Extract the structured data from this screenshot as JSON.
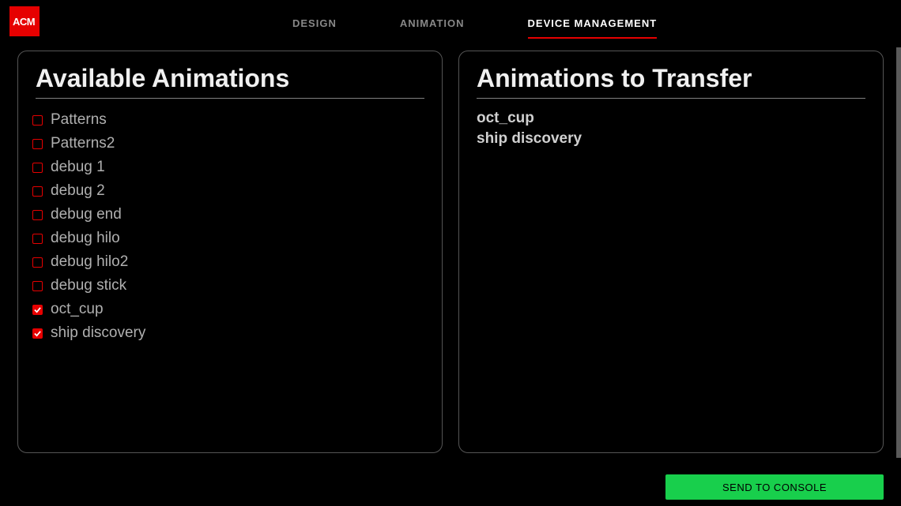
{
  "logo_text": "ACM",
  "tabs": [
    {
      "label": "DESIGN",
      "active": false
    },
    {
      "label": "ANIMATION",
      "active": false
    },
    {
      "label": "DEVICE MANAGEMENT",
      "active": true
    }
  ],
  "available": {
    "title": "Available Animations",
    "items": [
      {
        "label": "Patterns",
        "checked": false
      },
      {
        "label": "Patterns2",
        "checked": false
      },
      {
        "label": "debug 1",
        "checked": false
      },
      {
        "label": "debug 2",
        "checked": false
      },
      {
        "label": "debug end",
        "checked": false
      },
      {
        "label": "debug hilo",
        "checked": false
      },
      {
        "label": "debug hilo2",
        "checked": false
      },
      {
        "label": "debug stick",
        "checked": false
      },
      {
        "label": "oct_cup",
        "checked": true
      },
      {
        "label": "ship discovery",
        "checked": true
      }
    ]
  },
  "transfer": {
    "title": "Animations to Transfer",
    "items": [
      "oct_cup",
      "ship discovery"
    ]
  },
  "send_button_label": "SEND TO CONSOLE"
}
